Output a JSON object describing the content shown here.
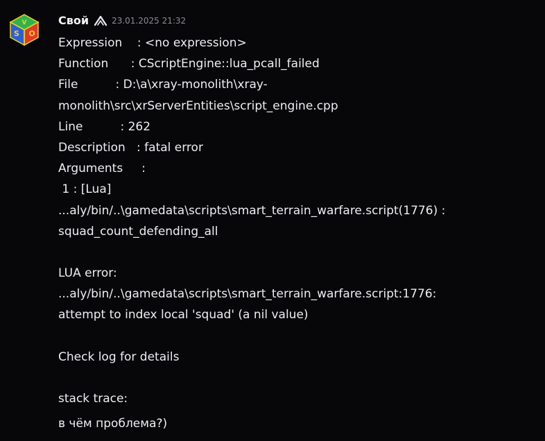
{
  "message": {
    "author": "Свой",
    "timestamp": "23.01.2025 21:32",
    "avatar": {
      "letters": [
        "S",
        "V",
        "O"
      ],
      "colors": [
        "#2a5fd6",
        "#29b04a",
        "#e23a2a",
        "#f3d21c"
      ]
    },
    "badge_icon": "chevron-up-icon",
    "lines": [
      "Expression    : <no expression>",
      "Function      : CScriptEngine::lua_pcall_failed",
      "File          : D:\\a\\xray-monolith\\xray-",
      "monolith\\src\\xrServerEntities\\script_engine.cpp",
      "Line          : 262",
      "Description   : fatal error",
      "Arguments     :",
      " 1 : [Lua]",
      "...aly/bin/..\\gamedata\\scripts\\smart_terrain_warfare.script(1776) :",
      "squad_count_defending_all",
      "",
      "LUA error:",
      "...aly/bin/..\\gamedata\\scripts\\smart_terrain_warfare.script:1776:",
      "attempt to index local 'squad' (a nil value)",
      "",
      "Check log for details",
      "",
      "stack trace:"
    ],
    "followup": "в чём проблема?)"
  }
}
